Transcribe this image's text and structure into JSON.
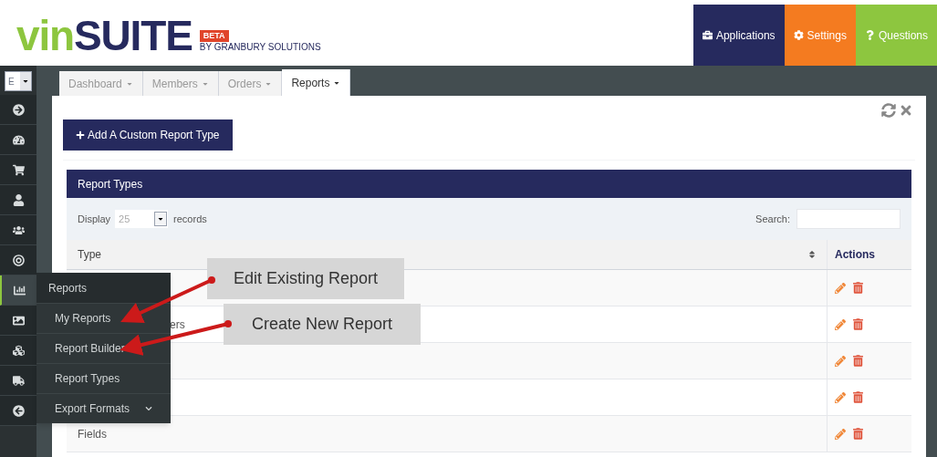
{
  "logo": {
    "name_start": "vin",
    "name_end": "SUITE",
    "badge": "BETA",
    "byline": "BY GRANBURY SOLUTIONS"
  },
  "top_nav": [
    {
      "kind": "applications",
      "label": "Applications"
    },
    {
      "kind": "settings",
      "label": "Settings"
    },
    {
      "kind": "questions",
      "label": "Questions"
    }
  ],
  "site_select": {
    "value": "E"
  },
  "tabs": [
    {
      "label": "Dashboard",
      "selected": false
    },
    {
      "label": "Members",
      "selected": false
    },
    {
      "label": "Orders",
      "selected": false
    },
    {
      "label": "Reports",
      "selected": true
    }
  ],
  "sidebar": [
    {
      "kind": "circle-right",
      "selected": false
    },
    {
      "kind": "gauge",
      "selected": false
    },
    {
      "kind": "cart",
      "selected": false
    },
    {
      "kind": "user",
      "selected": false
    },
    {
      "kind": "users",
      "selected": false
    },
    {
      "kind": "target",
      "selected": false
    },
    {
      "kind": "chart",
      "selected": true
    },
    {
      "kind": "image",
      "selected": false
    },
    {
      "kind": "cubes",
      "selected": false
    },
    {
      "kind": "truck",
      "selected": false
    },
    {
      "kind": "circle-left",
      "selected": false
    }
  ],
  "add_button": "Add A Custom Report Type",
  "panel": {
    "title": "Report Types",
    "display_label": "Display",
    "page_size": "25",
    "records_label": "records",
    "search_label": "Search:"
  },
  "table": {
    "columns": [
      "Type",
      "Actions"
    ],
    "rows": [
      {
        "kind": "covered"
      },
      {
        "kind": "partial",
        "type": "ers"
      },
      {
        "kind": "covered"
      },
      {
        "kind": "covered"
      },
      {
        "kind": "full",
        "type": "Fields"
      }
    ]
  },
  "flyout_menu": {
    "title": "Reports",
    "items": [
      {
        "label": "My Reports",
        "expandable": false
      },
      {
        "label": "Report Builder",
        "expandable": false
      },
      {
        "label": "Report Types",
        "expandable": false
      },
      {
        "label": "Export Formats",
        "expandable": true
      }
    ]
  },
  "callouts": [
    {
      "text": "Edit Existing Report"
    },
    {
      "text": "Create New Report"
    }
  ]
}
